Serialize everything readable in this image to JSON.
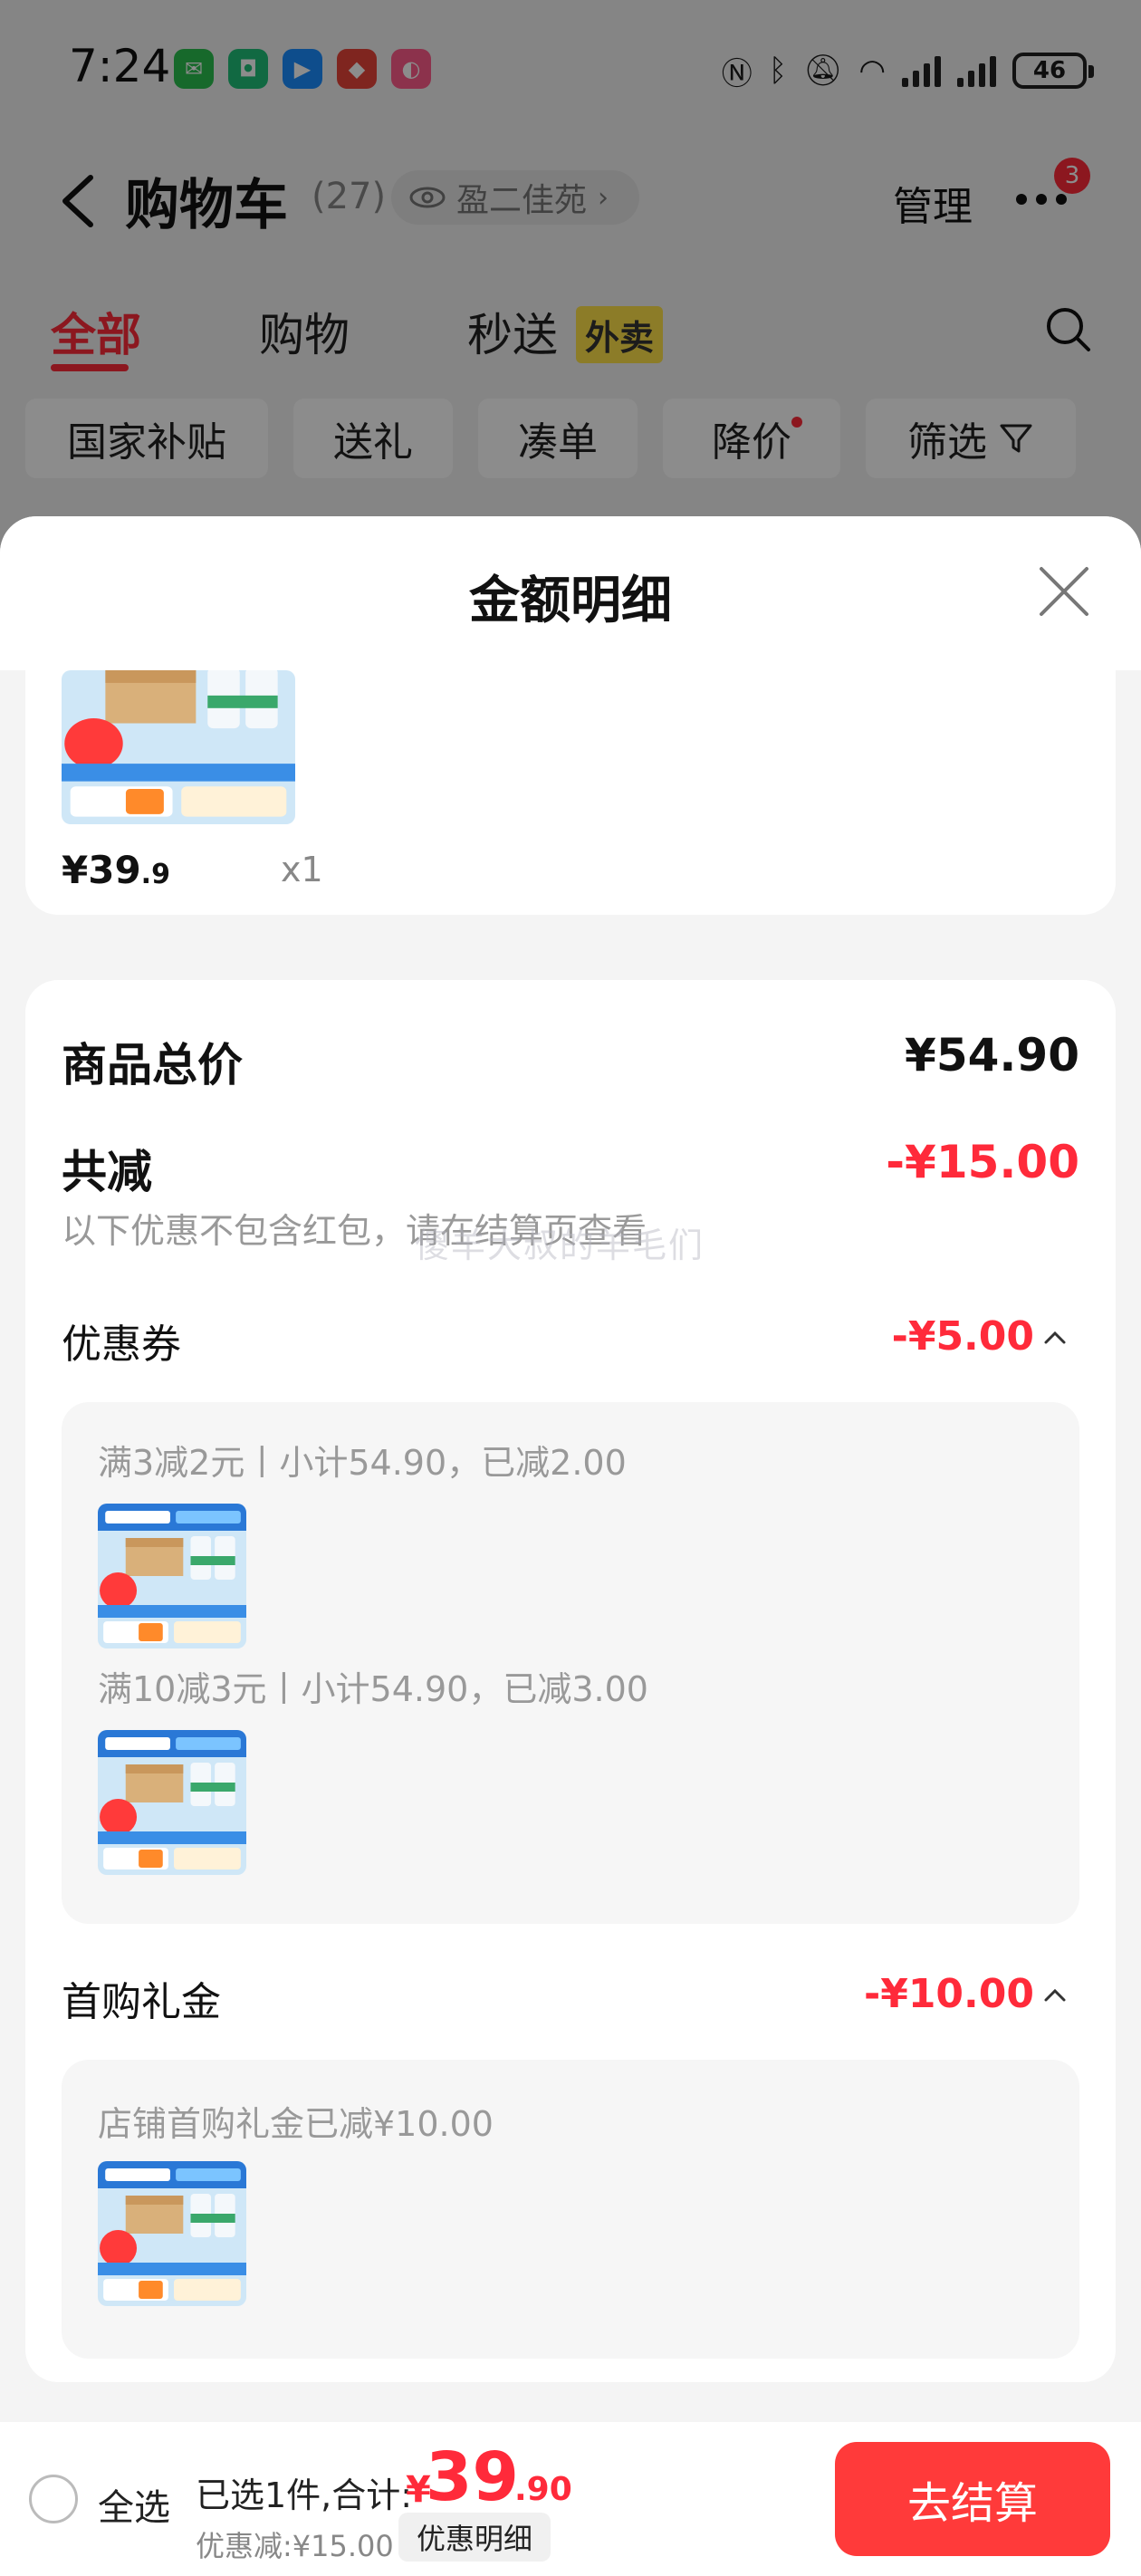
{
  "status_bar": {
    "time": "7:24",
    "battery": "46"
  },
  "header": {
    "title": "购物车",
    "count": "(27)",
    "address": "盈二佳苑",
    "manage": "管理",
    "badge": "3"
  },
  "tabs": {
    "all": "全部",
    "shopping": "购物",
    "instant": "秒送",
    "takeout": "外卖"
  },
  "filters": [
    "国家补贴",
    "送礼",
    "凑单",
    "降价",
    "筛选"
  ],
  "sheet": {
    "title": "金额明细",
    "product": {
      "price_int": "¥39",
      "price_dec": ".9",
      "qty": "x1"
    },
    "total_label": "商品总价",
    "total_value": "¥54.90",
    "reduce_label": "共减",
    "reduce_value": "-¥15.00",
    "note": "以下优惠不包含红包，请在结算页查看",
    "watermark": "傻羊大叔的羊毛们",
    "coupon": {
      "label": "优惠券",
      "value": "-¥5.00",
      "lines": [
        "满3减2元丨小计54.90，已减2.00",
        "满10减3元丨小计54.90，已减3.00"
      ]
    },
    "first_gift": {
      "label": "首购礼金",
      "value": "-¥10.00",
      "line": "店铺首购礼金已减¥10.00"
    }
  },
  "bottom": {
    "select_all": "全选",
    "selected_text": "已选1件,合计:",
    "total_currency": "¥",
    "total_int": "39",
    "total_dec": ".90",
    "discount": "优惠减:¥15.00",
    "detail_button": "优惠明细",
    "checkout": "去结算"
  },
  "colors": {
    "accent": "#ff2a3a",
    "takeout_tag": "#ffe24a"
  }
}
